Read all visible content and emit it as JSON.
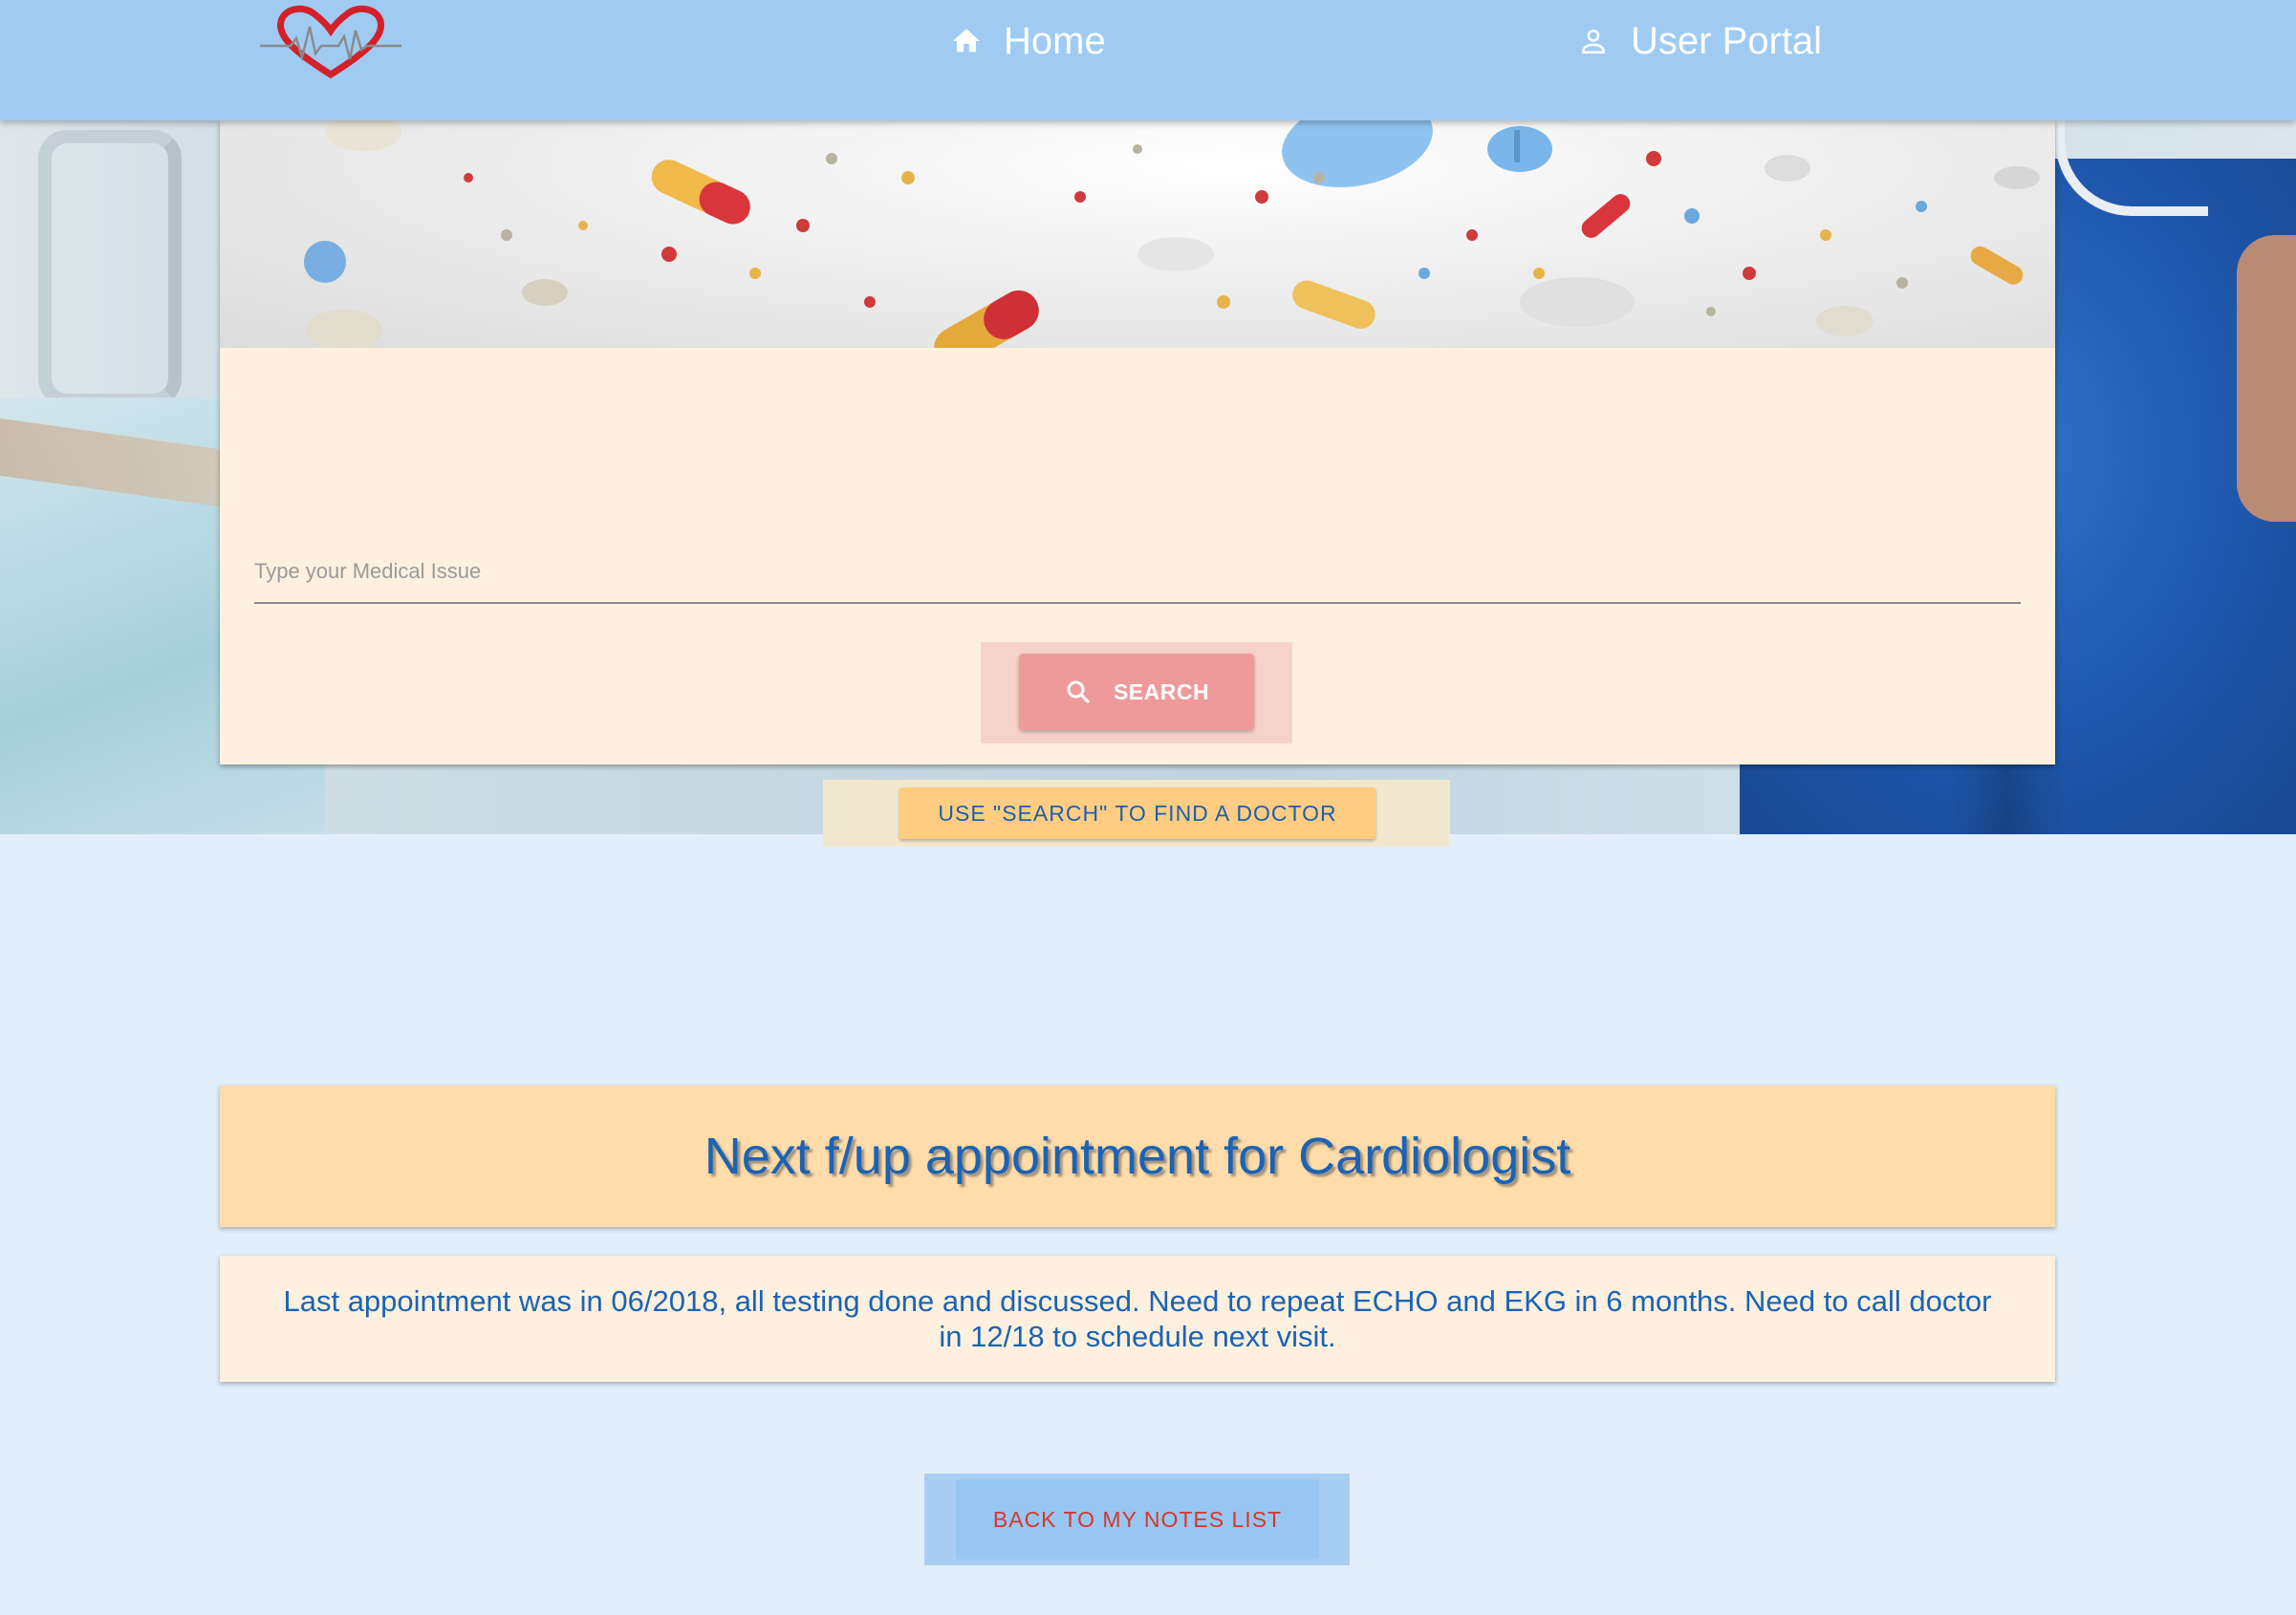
{
  "nav": {
    "home_label": "Home",
    "portal_label": "User Portal"
  },
  "search": {
    "placeholder": "Type your Medical Issue",
    "button_label": "SEARCH"
  },
  "find_doctor": {
    "label": "USE \"SEARCH\" TO FIND A DOCTOR"
  },
  "note": {
    "title": "Next f/up appointment for Cardiologist",
    "body": "Last appointment was in 06/2018, all testing done and discussed. Need to repeat ECHO and EKG in 6 months. Need to call doctor in 12/18 to schedule next visit."
  },
  "back": {
    "label": "BACK TO MY NOTES LIST"
  },
  "icons": {
    "logo": "heart-ekg-logo",
    "home": "home-icon",
    "portal": "user-icon",
    "search": "search-icon"
  },
  "colors": {
    "nav_bg": "#9fcbf3",
    "card_bg": "#fdf0de",
    "title_card_bg": "#ffdcaa",
    "text_blue": "#1b63b4",
    "search_button": "#ef9a9a",
    "find_button": "#ffcd82",
    "back_button": "#97c6f2",
    "back_text": "#d2382c"
  }
}
